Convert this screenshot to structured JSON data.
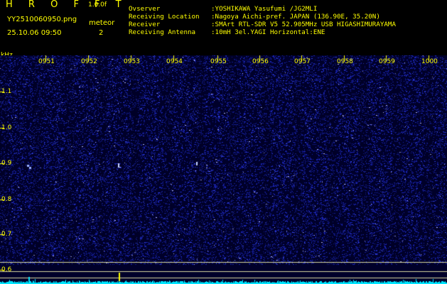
{
  "app": {
    "brand": "H R O F F T",
    "version": "1.0.0f"
  },
  "file": {
    "name": "YY2510060950.png",
    "timestamp": "25.10.06 09:50"
  },
  "meteor": {
    "label": "meteor",
    "count": "2"
  },
  "info": [
    {
      "key": "Ovserver",
      "value": ":YOSHIKAWA Yasufumi /JG2MLI"
    },
    {
      "key": "Receiving Location",
      "value": ":Nagoya Aichi-pref. JAPAN (136.90E, 35.20N)"
    },
    {
      "key": "Receiver",
      "value": ":SMArt RTL-SDR V5 52.905MHz USB HIGASHIMURAYAMA"
    },
    {
      "key": "Receiving Antenna",
      "value": ":10mH 3el.YAGI Horizontal:ENE"
    }
  ],
  "axis": {
    "unit": "kHz",
    "time_labels": [
      "0951",
      "0952",
      "0953",
      "0954",
      "0955",
      "0956",
      "0957",
      "0958",
      "0959",
      "1000"
    ],
    "freq_labels": [
      "1.1",
      "1.0",
      "0.9",
      "0.8",
      "0.7",
      "0.6"
    ]
  },
  "colors": {
    "text": "#ffff00",
    "background": "#000000",
    "noise": "#1d2bc8",
    "baseline": "#00e5ff"
  }
}
